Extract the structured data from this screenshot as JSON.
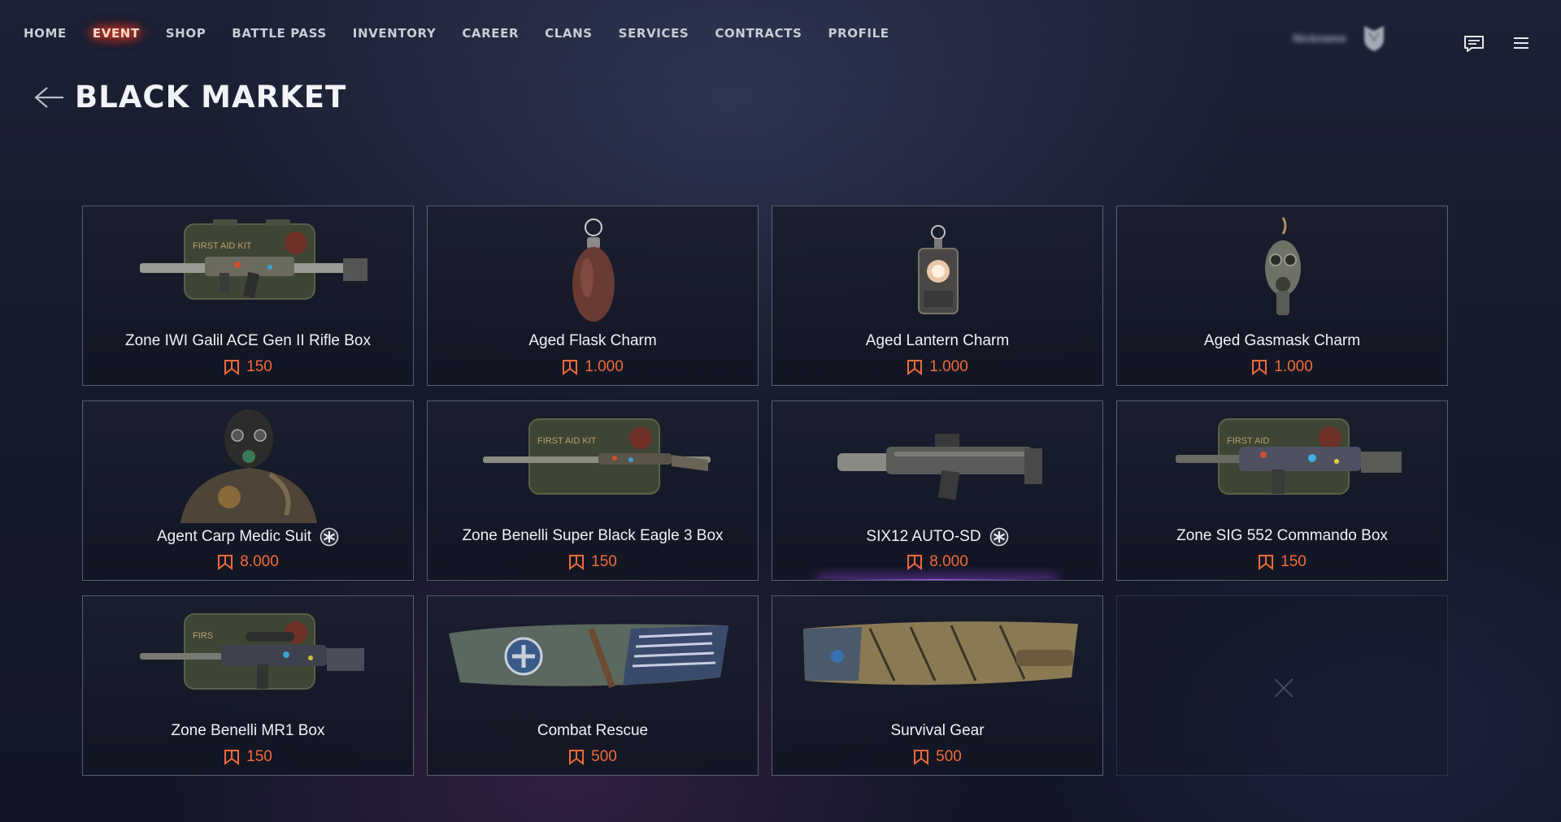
{
  "nav": {
    "items": [
      {
        "label": "HOME",
        "active": false
      },
      {
        "label": "EVENT",
        "active": true
      },
      {
        "label": "SHOP",
        "active": false
      },
      {
        "label": "BATTLE PASS",
        "active": false
      },
      {
        "label": "INVENTORY",
        "active": false
      },
      {
        "label": "CAREER",
        "active": false
      },
      {
        "label": "CLANS",
        "active": false
      },
      {
        "label": "SERVICES",
        "active": false
      },
      {
        "label": "CONTRACTS",
        "active": false
      },
      {
        "label": "PROFILE",
        "active": false
      }
    ],
    "username": "Nickname",
    "icons": {
      "chat": "chat-icon",
      "menu": "hamburger-menu-icon",
      "badge": "rank-badge-icon"
    }
  },
  "page": {
    "title": "BLACK MARKET",
    "back_icon": "arrow-left-icon"
  },
  "colors": {
    "accent_active": "#ff4a2a",
    "price": "#f06b3a",
    "rare_glow": "#b05cff"
  },
  "items": [
    {
      "name": "Zone IWI Galil ACE Gen II Rifle Box",
      "price": "150",
      "art": "weapon-case",
      "rare": false
    },
    {
      "name": "Aged Flask Charm",
      "price": "1.000",
      "art": "flask-charm",
      "rare": false
    },
    {
      "name": "Aged Lantern Charm",
      "price": "1.000",
      "art": "lantern-charm",
      "rare": false
    },
    {
      "name": "Aged Gasmask Charm",
      "price": "1.000",
      "art": "gasmask-charm",
      "rare": false
    },
    {
      "name": "Agent Carp Medic Suit",
      "price": "8.000",
      "art": "medic-suit",
      "rare": true
    },
    {
      "name": "Zone Benelli Super Black Eagle 3 Box",
      "price": "150",
      "art": "shotgun-case",
      "rare": false
    },
    {
      "name": "SIX12 AUTO-SD",
      "price": "8.000",
      "art": "six12-shotgun",
      "rare": true
    },
    {
      "name": "Zone SIG 552 Commando Box",
      "price": "150",
      "art": "weapon-case",
      "rare": false
    },
    {
      "name": "Zone Benelli MR1 Box",
      "price": "150",
      "art": "weapon-case",
      "rare": false
    },
    {
      "name": "Combat Rescue",
      "price": "500",
      "art": "bedroll-blue",
      "rare": false
    },
    {
      "name": "Survival Gear",
      "price": "500",
      "art": "bedroll-tan",
      "rare": false
    }
  ]
}
